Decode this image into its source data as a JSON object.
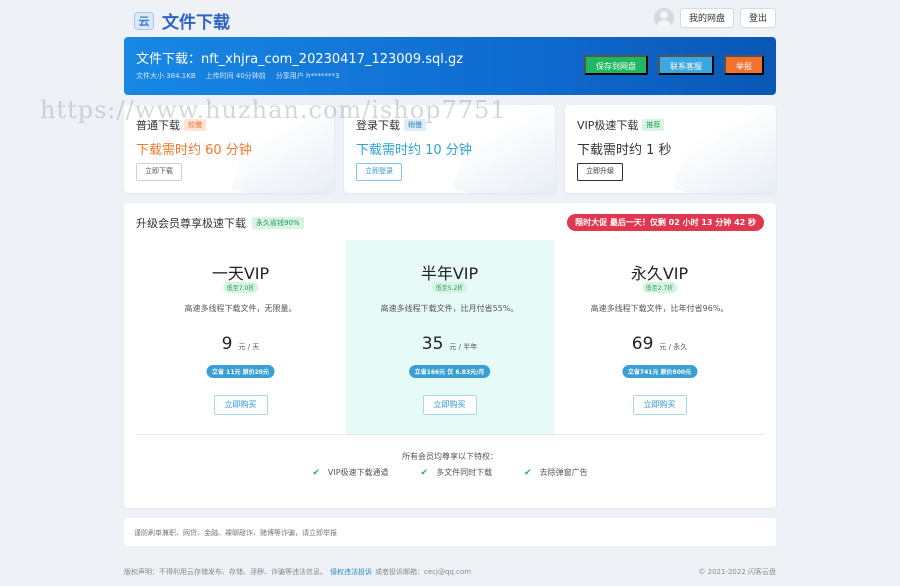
{
  "header": {
    "logo_icon": "云",
    "logo_text": "文件下载",
    "my_drive": "我的网盘",
    "logout": "登出"
  },
  "file": {
    "title": "文件下载：nft_xhjra_com_20230417_123009.sql.gz",
    "size": "文件大小 384.1KB",
    "upload_time": "上传时间 40分钟前",
    "uploader": "分享用户 h*******3",
    "save_btn": "保存到网盘",
    "contact_btn": "联系客服",
    "report_btn": "举报"
  },
  "watermark": "https://www.huzhan.com/ishop7751",
  "download_options": [
    {
      "name": "普通下载",
      "badge": "较慢",
      "time": "下载需时约 60 分钟",
      "button": "立即下载"
    },
    {
      "name": "登录下载",
      "badge": "稍慢",
      "time": "下载需时约 10 分钟",
      "button": "立即登录"
    },
    {
      "name": "VIP极速下载",
      "badge": "推荐",
      "time": "下载需时约 1 秒",
      "button": "立即升级"
    }
  ],
  "vip": {
    "title": "升级会员尊享极速下载",
    "title_badge": "永久省钱90%",
    "countdown": "限时大促 最后一天！仅剩 02 小时 13 分钟 42 秒",
    "plans": [
      {
        "name": "一天VIP",
        "discount": "低至7.0折",
        "desc": "高速多线程下载文件，无限量。",
        "price": "9",
        "unit": "元 / 天",
        "tag": "立省 11元 原价20元",
        "buy": "立即购买"
      },
      {
        "name": "半年VIP",
        "discount": "低至5.2折",
        "desc": "高速多线程下载文件，比月付省55%。",
        "price": "35",
        "unit": "元 / 半年",
        "tag": "立省166元 仅 6.83元/月",
        "buy": "立即购买"
      },
      {
        "name": "永久VIP",
        "discount": "低至2.7折",
        "desc": "高速多线程下载文件，比年付省96%。",
        "price": "69",
        "unit": "元 / 永久",
        "tag": "立省741元 原价800元",
        "buy": "立即购买"
      }
    ],
    "perks_title": "所有会员均尊享以下特权：",
    "perks": [
      "VIP极速下载通道",
      "多文件同时下载",
      "去除弹窗广告"
    ]
  },
  "notice": "谨防刷单兼职、网贷、金融、裸聊敲诈、赌博等诈骗，请立即举报",
  "footer": {
    "disclaimer": "版权声明：不得利用云存储发布、存储、淫秽、诈骗等违法信息。",
    "report_link": "侵权违法投诉",
    "email": "或者投诉邮箱：cecj@qq.com",
    "copyright": "© 2021-2022 闪客云盘"
  }
}
